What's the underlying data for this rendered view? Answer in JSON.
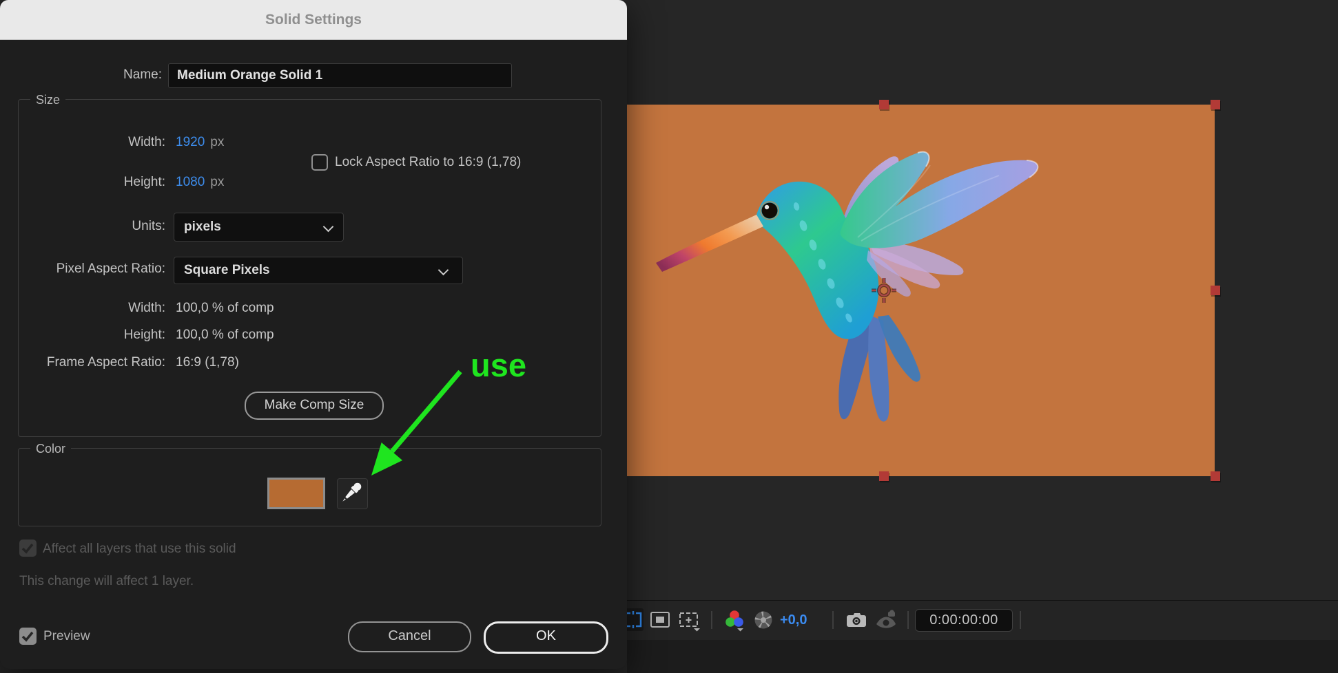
{
  "dialog": {
    "title": "Solid Settings",
    "name_label": "Name:",
    "name_value": "Medium Orange Solid 1",
    "size": {
      "legend": "Size",
      "width_label": "Width:",
      "width_value": "1920",
      "width_unit": "px",
      "height_label": "Height:",
      "height_value": "1080",
      "height_unit": "px",
      "lock_label": "Lock Aspect Ratio to 16:9 (1,78)",
      "units_label": "Units:",
      "units_value": "pixels",
      "par_label": "Pixel Aspect Ratio:",
      "par_value": "Square Pixels",
      "width_pct_label": "Width:",
      "width_pct_value": "100,0 % of comp",
      "height_pct_label": "Height:",
      "height_pct_value": "100,0 % of comp",
      "frame_ar_label": "Frame Aspect Ratio:",
      "frame_ar_value": "16:9 (1,78)",
      "make_comp_size_label": "Make Comp Size"
    },
    "color": {
      "legend": "Color",
      "swatch_color": "#b66b32"
    },
    "affect_label": "Affect all layers that use this solid",
    "affect_note": "This change will affect 1 layer.",
    "preview_label": "Preview",
    "cancel_label": "Cancel",
    "ok_label": "OK",
    "value_accent_color": "#3d8ceb"
  },
  "annotation": {
    "text": "use",
    "color": "#1fe51f"
  },
  "viewer": {
    "solid_color": "#c3743e",
    "selection_handle_color": "#b23a36",
    "toolbar": {
      "icons": [
        "region-of-interest",
        "transparency-grid",
        "grid-and-guide-options",
        "channel-and-color-settings",
        "exposure-shutter",
        "snapshot-camera",
        "show-snapshot"
      ],
      "exposure_value": "+0,0",
      "timecode": "0:00:00:00"
    }
  }
}
